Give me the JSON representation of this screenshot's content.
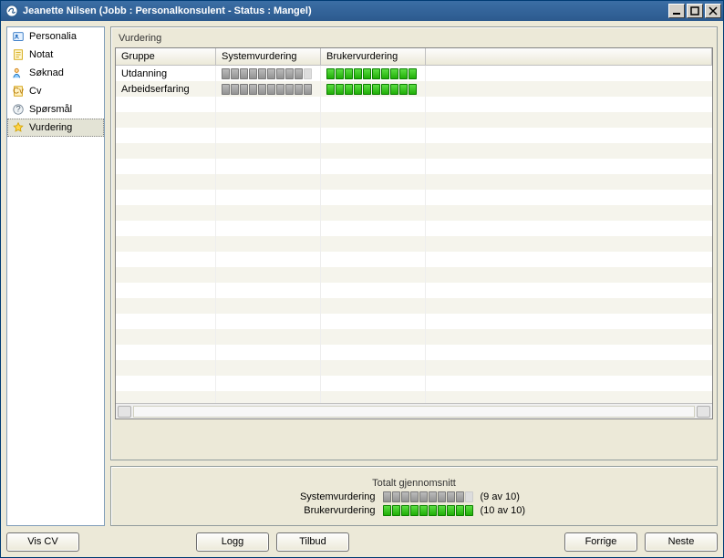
{
  "window": {
    "title": "Jeanette Nilsen (Jobb : Personalkonsulent - Status : Mangel)"
  },
  "sidebar": {
    "items": [
      {
        "label": "Personalia"
      },
      {
        "label": "Notat"
      },
      {
        "label": "Søknad"
      },
      {
        "label": "Cv"
      },
      {
        "label": "Spørsmål"
      },
      {
        "label": "Vurdering"
      }
    ]
  },
  "panel": {
    "title": "Vurdering",
    "columns": {
      "gruppe": "Gruppe",
      "system": "Systemvurdering",
      "bruker": "Brukervurdering"
    },
    "rows": [
      {
        "gruppe": "Utdanning",
        "system": 9,
        "bruker": 10,
        "max": 10
      },
      {
        "gruppe": "Arbeidserfaring",
        "system": 10,
        "bruker": 10,
        "max": 10
      }
    ]
  },
  "totals": {
    "title": "Totalt gjennomsnitt",
    "system_label": "Systemvurdering",
    "system_value": 9,
    "system_text": "(9 av 10)",
    "bruker_label": "Brukervurdering",
    "bruker_value": 10,
    "bruker_text": "(10 av 10)",
    "max": 10
  },
  "buttons": {
    "vis_cv": "Vis CV",
    "logg": "Logg",
    "tilbud": "Tilbud",
    "forrige": "Forrige",
    "neste": "Neste"
  }
}
